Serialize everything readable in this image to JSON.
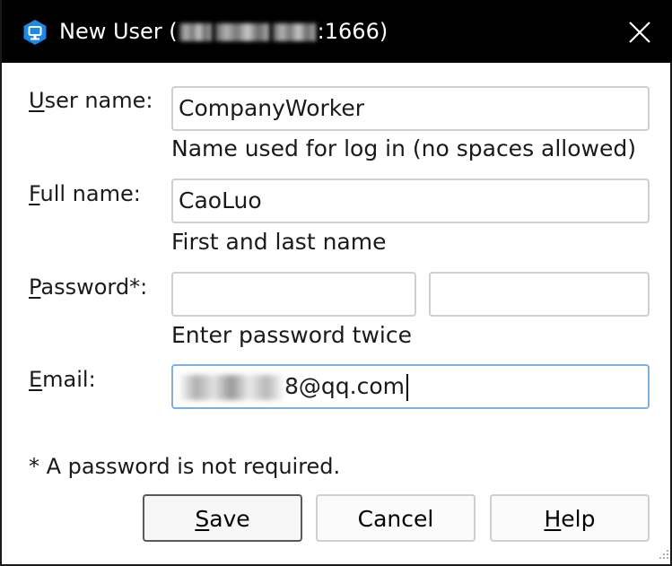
{
  "window": {
    "title_prefix": "New User (",
    "title_suffix": ":1666)",
    "icon": "p4-app-icon",
    "close_icon": "close-icon"
  },
  "form": {
    "username": {
      "label_mnemonic": "U",
      "label_rest": "ser name:",
      "value": "CompanyWorker",
      "hint": "Name used for log in (no spaces allowed)"
    },
    "fullname": {
      "label_mnemonic": "F",
      "label_rest": "ull name:",
      "value": "CaoLuo",
      "hint": "First and last name"
    },
    "password": {
      "label_mnemonic": "P",
      "label_rest": "assword*:",
      "value": "",
      "confirm_value": "",
      "hint": "Enter password twice"
    },
    "email": {
      "label_mnemonic": "E",
      "label_rest": "mail:",
      "value_visible": "8@qq.com"
    }
  },
  "note": "* A password is not required.",
  "buttons": {
    "save_mnemonic": "S",
    "save_rest": "ave",
    "cancel": "Cancel",
    "help_mnemonic": "H",
    "help_rest": "elp"
  },
  "colors": {
    "titlebar": "#000000",
    "icon_blue": "#1e88e5",
    "focus_border": "#7db0dd"
  }
}
